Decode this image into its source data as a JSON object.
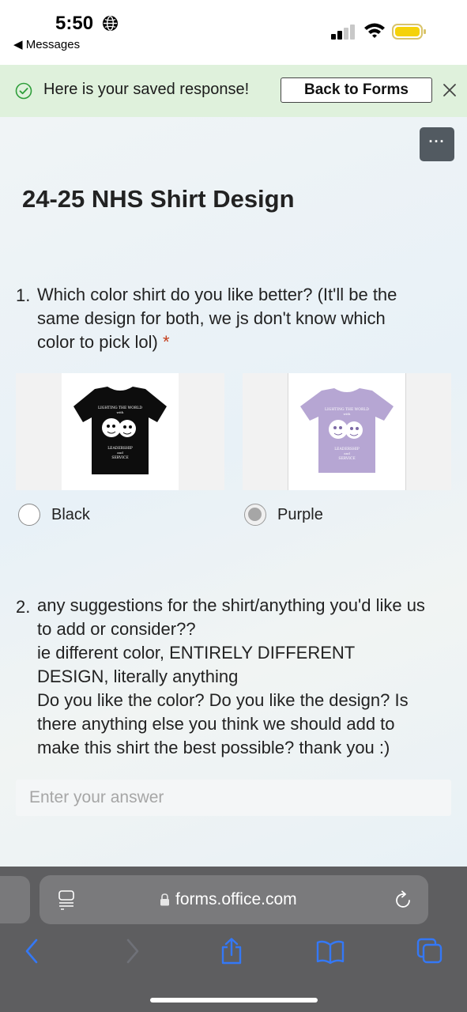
{
  "status_bar": {
    "time": "5:50",
    "back_app": "◀ Messages"
  },
  "banner": {
    "message": "Here is your saved response!",
    "back_button": "Back to Forms",
    "status_color": "#2e9e3a"
  },
  "form": {
    "title": "24-25 NHS Shirt Design",
    "more_label": "···",
    "questions": [
      {
        "number": "1.",
        "lines": [
          "Which color shirt do you like better? (It'll be the",
          "same design for both, we js don't know which",
          "color to pick lol)"
        ],
        "required_mark": "*",
        "options": [
          {
            "label": "Black",
            "selected": false,
            "shirt_color": "#0d0d0d",
            "design_text": [
              "LIGHTING THE WORLD",
              "with",
              "LEADERSHIP",
              "and",
              "SERVICE"
            ]
          },
          {
            "label": "Purple",
            "selected": true,
            "shirt_color": "#b6a6d3",
            "design_text": [
              "LIGHTING THE WORLD",
              "with",
              "LEADERSHIP",
              "and",
              "SERVICE"
            ]
          }
        ]
      },
      {
        "number": "2.",
        "lines": [
          "any suggestions for the shirt/anything you'd like us",
          "to add or consider??",
          "ie different color, ENTIRELY DIFFERENT",
          "DESIGN, literally anything",
          "Do you like the color? Do you like the design? Is",
          "there anything else you think we should add to",
          "make this shirt the best possible? thank you :)"
        ],
        "answer_placeholder": "Enter your answer",
        "answer_value": ""
      }
    ]
  },
  "browser": {
    "url": "forms.office.com",
    "accent_color": "#3478f6"
  }
}
